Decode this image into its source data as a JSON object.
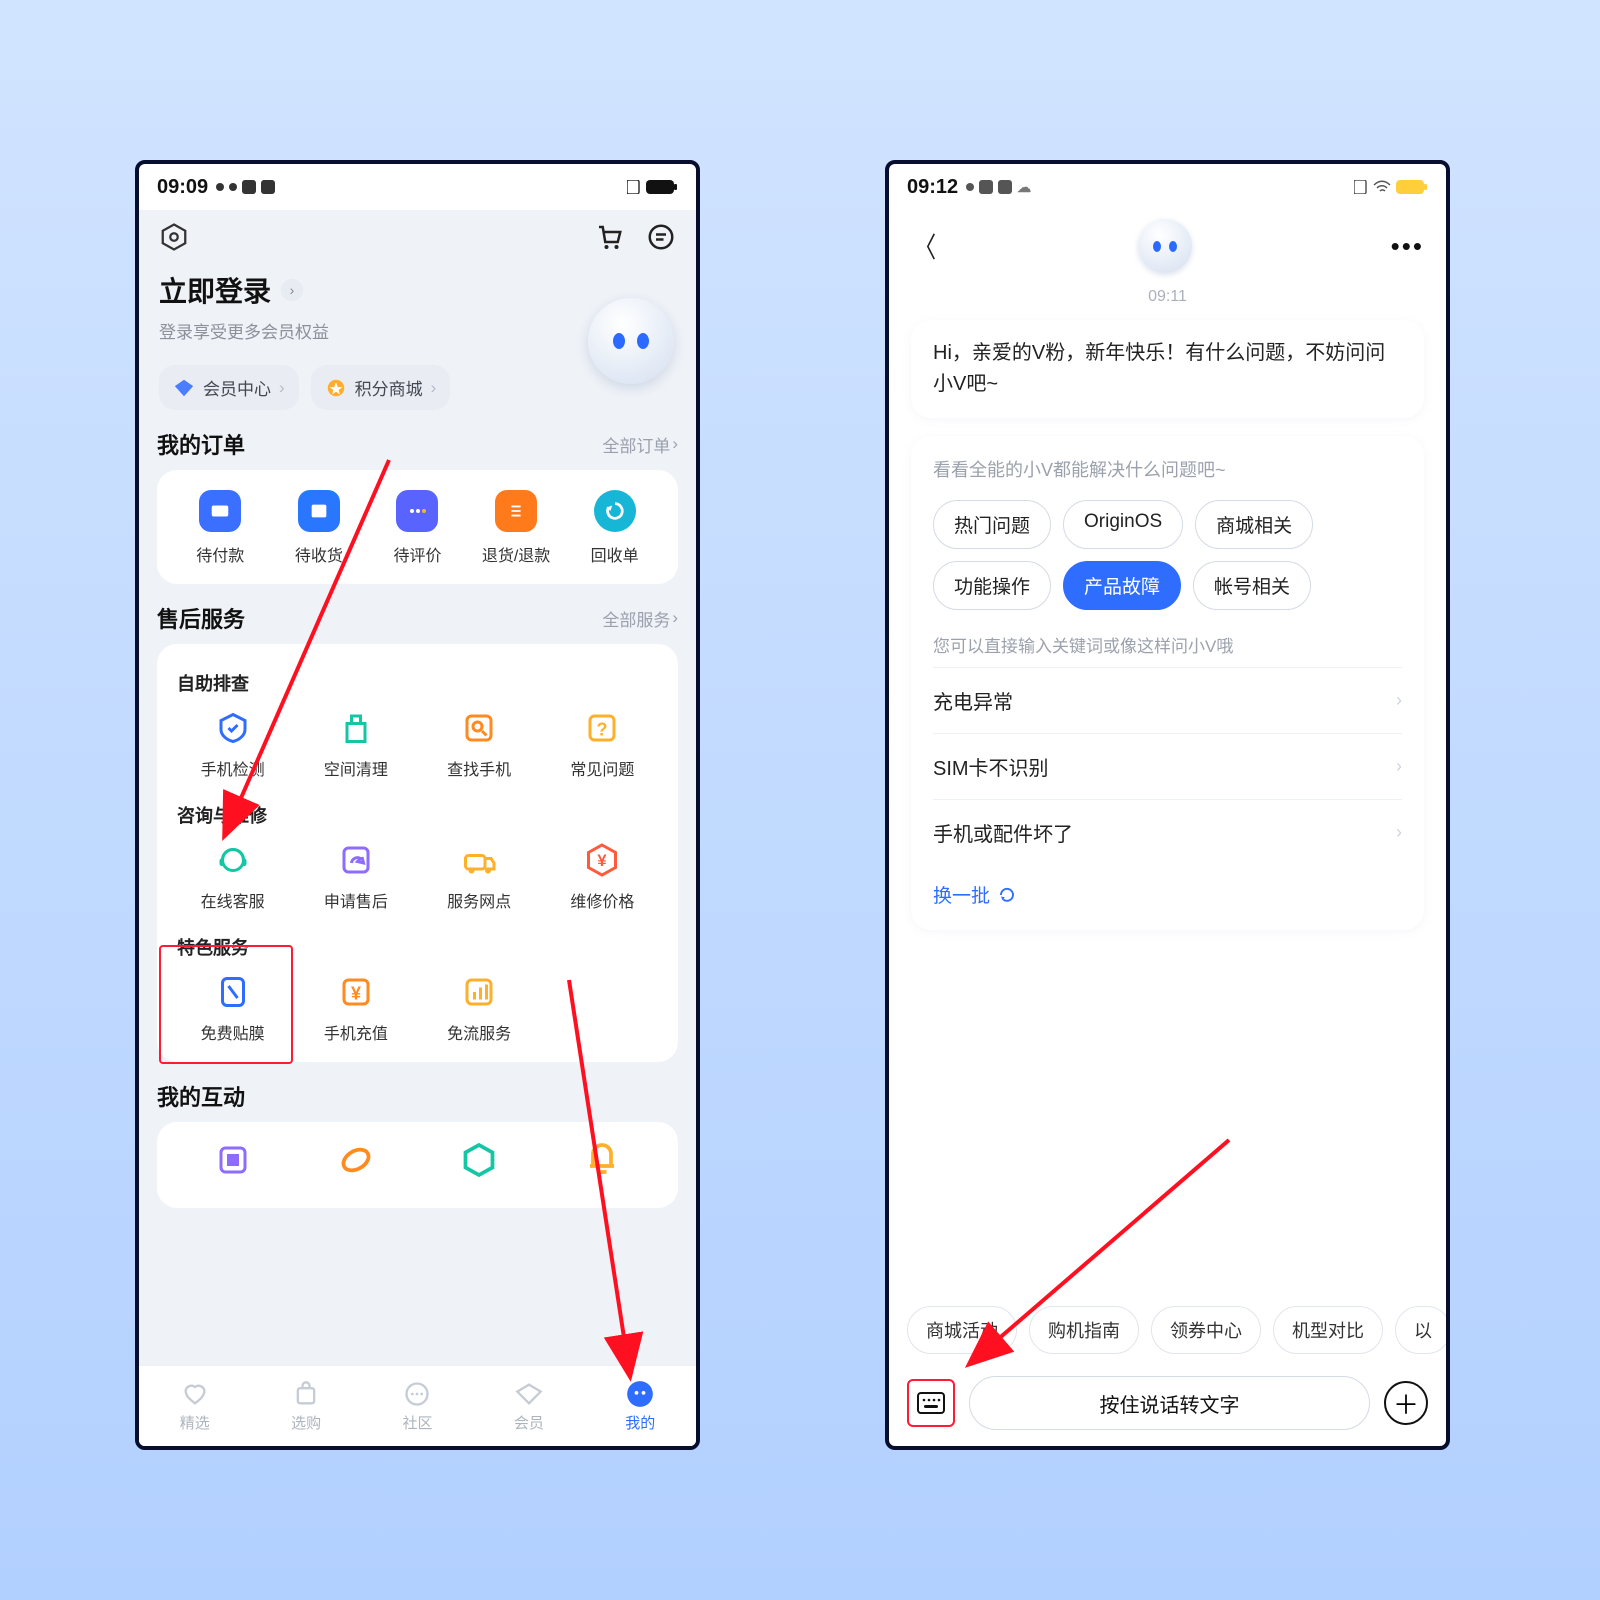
{
  "left": {
    "status_time": "09:09",
    "login_title": "立即登录",
    "login_sub": "登录享受更多会员权益",
    "chips": {
      "member": "会员中心",
      "points": "积分商城"
    },
    "orders": {
      "title": "我的订单",
      "more": "全部订单",
      "items": [
        {
          "label": "待付款"
        },
        {
          "label": "待收货"
        },
        {
          "label": "待评价"
        },
        {
          "label": "退货/退款"
        },
        {
          "label": "回收单"
        }
      ]
    },
    "aftersale": {
      "title": "售后服务",
      "more": "全部服务",
      "groups": [
        {
          "title": "自助排查",
          "items": [
            {
              "label": "手机检测"
            },
            {
              "label": "空间清理"
            },
            {
              "label": "查找手机"
            },
            {
              "label": "常见问题"
            }
          ]
        },
        {
          "title": "咨询与维修",
          "items": [
            {
              "label": "在线客服"
            },
            {
              "label": "申请售后"
            },
            {
              "label": "服务网点"
            },
            {
              "label": "维修价格"
            }
          ]
        },
        {
          "title": "特色服务",
          "items": [
            {
              "label": "免费贴膜"
            },
            {
              "label": "手机充值"
            },
            {
              "label": "免流服务"
            }
          ]
        }
      ]
    },
    "interaction_title": "我的互动",
    "nav": [
      {
        "label": "精选"
      },
      {
        "label": "选购"
      },
      {
        "label": "社区"
      },
      {
        "label": "会员"
      },
      {
        "label": "我的"
      }
    ]
  },
  "right": {
    "status_time": "09:12",
    "chat_time": "09:11",
    "greeting": "Hi，亲爱的V粉，新年快乐！有什么问题，不妨问问小V吧~",
    "card": {
      "head": "看看全能的小V都能解决什么问题吧~",
      "pills": [
        "热门问题",
        "OriginOS",
        "商城相关",
        "功能操作",
        "产品故障",
        "帐号相关"
      ],
      "active_pill": "产品故障",
      "tip": "您可以直接输入关键词或像这样问小V哦",
      "items": [
        "充电异常",
        "SIM卡不识别",
        "手机或配件坏了"
      ],
      "refresh": "换一批"
    },
    "quick": [
      "商城活动",
      "购机指南",
      "领券中心",
      "机型对比",
      "以"
    ],
    "voice": "按住说话转文字"
  }
}
